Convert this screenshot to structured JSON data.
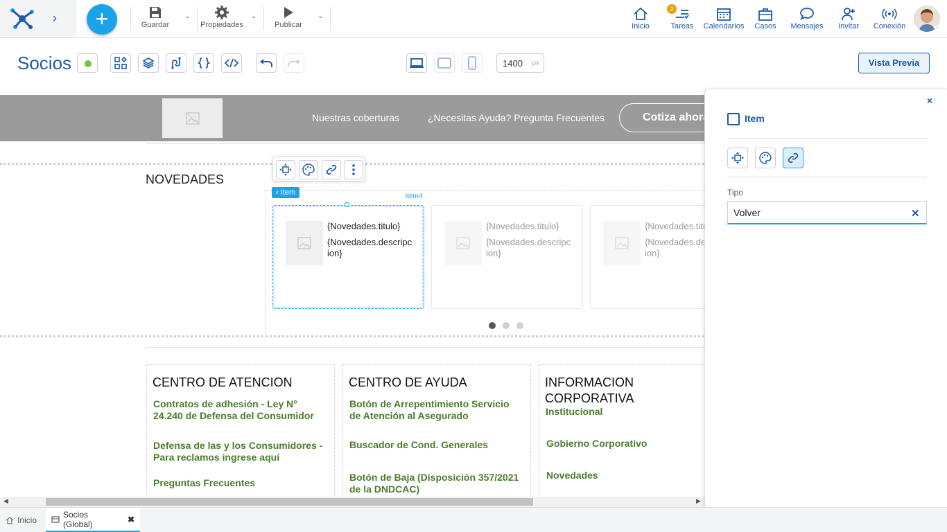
{
  "topbar": {
    "new_label": "+",
    "toolbar": {
      "save": "Guardar",
      "properties": "Propiedades",
      "publish": "Publicar"
    },
    "nav": {
      "home": "Inicio",
      "tasks": "Tareas",
      "tasks_badge": "2",
      "calendars": "Calendarios",
      "cases": "Casos",
      "messages": "Mensajes",
      "invite": "Invitar",
      "connection": "Conexión"
    }
  },
  "editor": {
    "title": "Socios",
    "width_value": "1400",
    "width_unit": "px",
    "preview_label": "Vista Previa"
  },
  "site": {
    "nav_links": [
      "Nuestras coberturas",
      "¿Necesitas Ayuda? Pregunta Frecuentes"
    ],
    "cta": "Cotiza ahora",
    "news_title": "NOVEDADES",
    "item_tag": "Item",
    "item_id": "item4",
    "cards": [
      {
        "title": "{Novedades.titulo}",
        "desc": "{Novedades.descripcion}"
      },
      {
        "title": "{Novedades.titulo}",
        "desc": "{Novedades.descripcion}"
      },
      {
        "title": "{Novedades.titulo}",
        "desc": "{Novedades.descripcion}"
      }
    ],
    "footer": [
      {
        "heading": "CENTRO DE ATENCION",
        "links": [
          "Contratos de adhesión - Ley N° 24.240 de Defensa del Consumidor",
          "Defensa de las y los Consumidores - Para reclamos ingrese aquí",
          "Preguntas Frecuentes"
        ]
      },
      {
        "heading": "CENTRO DE AYUDA",
        "links": [
          "Botón de Arrepentimiento Servicio de Atención al Asegurado",
          "Buscador de Cond. Generales",
          "Botón de Baja (Disposición 357/2021 de la DNDCAC)"
        ]
      },
      {
        "heading": "INFORMACION CORPORATIVA",
        "links": [
          "Institucional",
          "Gobierno Corporativo",
          "Novedades"
        ]
      }
    ]
  },
  "panel": {
    "close": "×",
    "checkbox_label": "Item",
    "tipo_label": "Tipo",
    "tipo_value": "Volver",
    "clear": "✕"
  },
  "tabs": [
    {
      "label": "Inicio",
      "icon": "home-icon"
    },
    {
      "label": "Socios (Global)",
      "icon": "page-icon",
      "close": "✖"
    }
  ],
  "colors": {
    "brand": "#1f5aa8",
    "accent": "#1aa3ea",
    "link_green": "#4a7d2b",
    "status_green": "#7bc043"
  }
}
